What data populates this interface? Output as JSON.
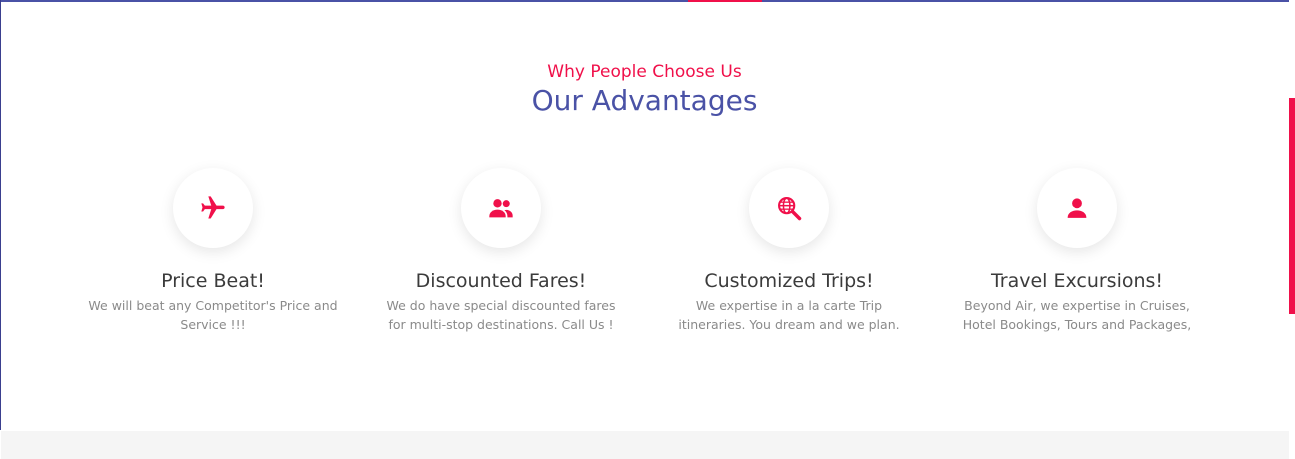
{
  "section": {
    "subtitle": "Why People Choose Us",
    "title": "Our Advantages"
  },
  "colors": {
    "accent": "#f0104a",
    "brand": "#4a52a6",
    "heading": "#3b3b3b",
    "text": "#8a8a8a"
  },
  "features": [
    {
      "icon": "airplane-icon",
      "title": "Price Beat!",
      "desc": "We will beat any Competitor's Price and Service !!!"
    },
    {
      "icon": "users-icon",
      "title": "Discounted Fares!",
      "desc": "We do have special discounted fares for multi-stop destinations. Call Us !"
    },
    {
      "icon": "globe-search-icon",
      "title": "Customized Trips!",
      "desc": "We expertise in a la carte Trip itineraries. You dream and we plan."
    },
    {
      "icon": "user-icon",
      "title": "Travel Excursions!",
      "desc": "Beyond Air, we expertise in Cruises, Hotel Bookings, Tours and Packages,"
    }
  ]
}
